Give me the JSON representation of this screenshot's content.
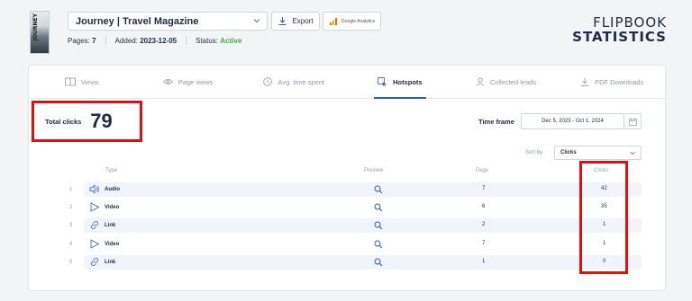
{
  "header": {
    "thumbnail_title": "JOURNEY",
    "magazine_title": "Journey | Travel Magazine",
    "export_label": "Export",
    "ga_label": "Google Analytics",
    "pages_label": "Pages:",
    "pages_value": "7",
    "added_label": "Added:",
    "added_value": "2023-12-05",
    "status_label": "Status:",
    "status_value": "Active",
    "brand_line1": "FLIPBOOK",
    "brand_line2": "STATISTICS"
  },
  "tabs": [
    {
      "label": "Views",
      "icon": "book-icon",
      "active": false
    },
    {
      "label": "Page views",
      "icon": "eye-icon",
      "active": false
    },
    {
      "label": "Avg. time spent",
      "icon": "clock-icon",
      "active": false
    },
    {
      "label": "Hotspots",
      "icon": "hotspot-icon",
      "active": true
    },
    {
      "label": "Collected leads",
      "icon": "user-icon",
      "active": false
    },
    {
      "label": "PDF Downloads",
      "icon": "download-icon",
      "active": false
    }
  ],
  "summary": {
    "total_clicks_label": "Total clicks",
    "total_clicks_value": "79",
    "time_frame_label": "Time frame",
    "time_frame_value": "Dec 5, 2023 - Oct 1, 2024",
    "sort_by_label": "Sort by",
    "sort_by_value": "Clicks"
  },
  "table": {
    "headers": {
      "type": "Type",
      "preview": "Preview",
      "page": "Page",
      "clicks": "Clicks"
    },
    "rows": [
      {
        "index": "1",
        "type": "Audio",
        "icon": "audio-icon",
        "page": "7",
        "clicks": "42"
      },
      {
        "index": "2",
        "type": "Video",
        "icon": "play-icon",
        "page": "6",
        "clicks": "35"
      },
      {
        "index": "3",
        "type": "Link",
        "icon": "link-icon",
        "page": "2",
        "clicks": "1"
      },
      {
        "index": "4",
        "type": "Video",
        "icon": "play-icon",
        "page": "7",
        "clicks": "1"
      },
      {
        "index": "5",
        "type": "Link",
        "icon": "link-icon",
        "page": "1",
        "clicks": "0"
      }
    ]
  },
  "colors": {
    "accent": "#2d5fb8",
    "status_active": "#3fae3f",
    "highlight": "#e01010"
  }
}
